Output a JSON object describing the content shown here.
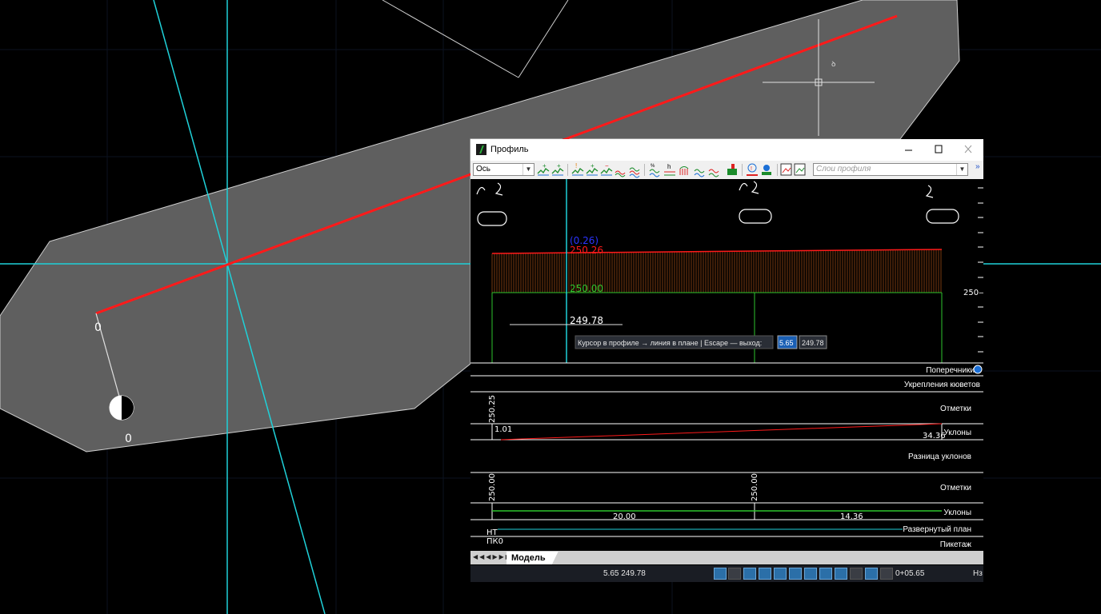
{
  "cad": {
    "plan_labels": {
      "pin_label_upper": "0",
      "pin_label_lower": "0"
    },
    "crosshair_glyph": "ꝺ"
  },
  "window": {
    "title": "Профиль",
    "minimize_icon": "minimize-icon",
    "maximize_icon": "maximize-icon",
    "close_icon": "close-icon"
  },
  "toolbar": {
    "axis_select": "Ось",
    "layers_placeholder": "Слои профиля",
    "more_chevron": "»"
  },
  "profile": {
    "vertex_marks": [
      "0 2",
      "0 2",
      "0 2"
    ],
    "labels": {
      "design_level": "(0.26)",
      "top_level": "250.26",
      "ground_level": "250.00",
      "cursor_level": "249.78"
    },
    "axis_tick_label": "250—",
    "cursor_prompt": "Курсор в профиле → линия в плане  |  Escape — выход:",
    "input_x": "5.65",
    "input_y": "249.78"
  },
  "bands": {
    "rows": [
      {
        "label": "Поперечники"
      },
      {
        "label": "Укрепления кюветов"
      },
      {
        "label": "Отметки"
      },
      {
        "label": "Уклоны"
      },
      {
        "label": "Разница уклонов"
      },
      {
        "label": "Отметки"
      },
      {
        "label": "Уклоны"
      },
      {
        "label": "Развернутый план"
      },
      {
        "label": "Пикетаж"
      }
    ],
    "top_elevation": "250.25",
    "slope_start": "1.01",
    "slope_end": "34.36",
    "ground_elevations": [
      "250.00",
      "250.00"
    ],
    "ground_lengths": [
      "20.00",
      "14.36"
    ],
    "plan_text": "НТ",
    "picket_text": "ПК0"
  },
  "tabs": {
    "model": "Модель"
  },
  "status": {
    "coords": "5.65 249.78",
    "station": "0+05.65",
    "ns": "Нз"
  },
  "colors": {
    "cyan": "#1fd1d9",
    "red": "#ff1a1a",
    "green": "#2ec52e",
    "fill_orange": "#7a3a10",
    "gray_polygon": "#5f5f5f",
    "blue": "#2b34ff"
  }
}
